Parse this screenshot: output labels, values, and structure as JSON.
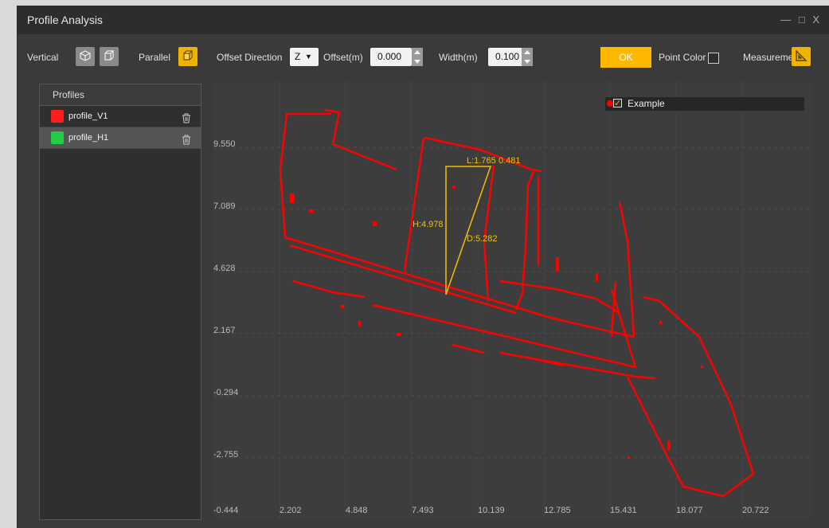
{
  "window": {
    "title": "Profile Analysis",
    "controls": "— □ X"
  },
  "toolbar": {
    "vertical_label": "Vertical",
    "parallel_label": "Parallel",
    "offset_direction_label": "Offset Direction",
    "offset_direction_value": "Z",
    "offset_label": "Offset(m)",
    "offset_value": "0.000",
    "width_label": "Width(m)",
    "width_value": "0.100",
    "ok_label": "OK",
    "point_color_label": "Point Color",
    "measurement_label": "Measurement"
  },
  "profiles": {
    "header": "Profiles",
    "items": [
      {
        "name": "profile_V1",
        "color": "#ff1e1e",
        "selected": false
      },
      {
        "name": "profile_H1",
        "color": "#22cc44",
        "selected": true
      }
    ]
  },
  "plot": {
    "legend_label": "Example",
    "y_ticks": [
      "9.550",
      "7.089",
      "4.628",
      "2.167",
      "-0.294",
      "-2.755"
    ],
    "x_ticks": [
      "-0.444",
      "2.202",
      "4.848",
      "7.493",
      "10.139",
      "12.785",
      "15.431",
      "18.077",
      "20.722"
    ],
    "measurement": {
      "length": "L:1.765",
      "angle": "0.481",
      "height": "H:4.978",
      "distance": "D:5.282"
    },
    "point_color": "#ff0000",
    "measure_color": "#f0c000"
  }
}
